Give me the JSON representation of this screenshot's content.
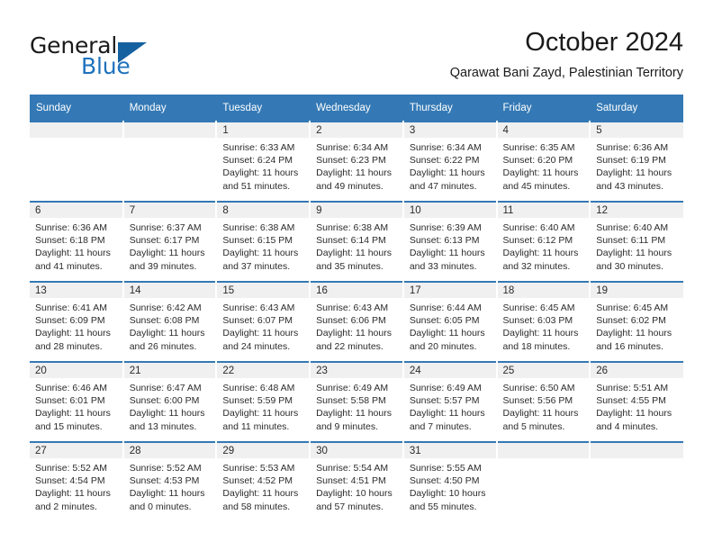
{
  "brand": {
    "name_top": "General",
    "name_bottom": "Blue",
    "accent_color": "#1f72bd",
    "triangle_color": "#15619f"
  },
  "header": {
    "month_title": "October 2024",
    "location": "Qarawat Bani Zayd, Palestinian Territory"
  },
  "theme": {
    "header_row_bg": "#3479b5",
    "date_band_bg": "#f0f0f0",
    "text_color": "#2b2b2b"
  },
  "calendar": {
    "weekday_headers": [
      "Sunday",
      "Monday",
      "Tuesday",
      "Wednesday",
      "Thursday",
      "Friday",
      "Saturday"
    ],
    "weeks": [
      [
        {
          "day": "",
          "sunrise": "",
          "sunset": "",
          "daylight_line1": "",
          "daylight_line2": ""
        },
        {
          "day": "",
          "sunrise": "",
          "sunset": "",
          "daylight_line1": "",
          "daylight_line2": ""
        },
        {
          "day": "1",
          "sunrise": "Sunrise: 6:33 AM",
          "sunset": "Sunset: 6:24 PM",
          "daylight_line1": "Daylight: 11 hours",
          "daylight_line2": "and 51 minutes."
        },
        {
          "day": "2",
          "sunrise": "Sunrise: 6:34 AM",
          "sunset": "Sunset: 6:23 PM",
          "daylight_line1": "Daylight: 11 hours",
          "daylight_line2": "and 49 minutes."
        },
        {
          "day": "3",
          "sunrise": "Sunrise: 6:34 AM",
          "sunset": "Sunset: 6:22 PM",
          "daylight_line1": "Daylight: 11 hours",
          "daylight_line2": "and 47 minutes."
        },
        {
          "day": "4",
          "sunrise": "Sunrise: 6:35 AM",
          "sunset": "Sunset: 6:20 PM",
          "daylight_line1": "Daylight: 11 hours",
          "daylight_line2": "and 45 minutes."
        },
        {
          "day": "5",
          "sunrise": "Sunrise: 6:36 AM",
          "sunset": "Sunset: 6:19 PM",
          "daylight_line1": "Daylight: 11 hours",
          "daylight_line2": "and 43 minutes."
        }
      ],
      [
        {
          "day": "6",
          "sunrise": "Sunrise: 6:36 AM",
          "sunset": "Sunset: 6:18 PM",
          "daylight_line1": "Daylight: 11 hours",
          "daylight_line2": "and 41 minutes."
        },
        {
          "day": "7",
          "sunrise": "Sunrise: 6:37 AM",
          "sunset": "Sunset: 6:17 PM",
          "daylight_line1": "Daylight: 11 hours",
          "daylight_line2": "and 39 minutes."
        },
        {
          "day": "8",
          "sunrise": "Sunrise: 6:38 AM",
          "sunset": "Sunset: 6:15 PM",
          "daylight_line1": "Daylight: 11 hours",
          "daylight_line2": "and 37 minutes."
        },
        {
          "day": "9",
          "sunrise": "Sunrise: 6:38 AM",
          "sunset": "Sunset: 6:14 PM",
          "daylight_line1": "Daylight: 11 hours",
          "daylight_line2": "and 35 minutes."
        },
        {
          "day": "10",
          "sunrise": "Sunrise: 6:39 AM",
          "sunset": "Sunset: 6:13 PM",
          "daylight_line1": "Daylight: 11 hours",
          "daylight_line2": "and 33 minutes."
        },
        {
          "day": "11",
          "sunrise": "Sunrise: 6:40 AM",
          "sunset": "Sunset: 6:12 PM",
          "daylight_line1": "Daylight: 11 hours",
          "daylight_line2": "and 32 minutes."
        },
        {
          "day": "12",
          "sunrise": "Sunrise: 6:40 AM",
          "sunset": "Sunset: 6:11 PM",
          "daylight_line1": "Daylight: 11 hours",
          "daylight_line2": "and 30 minutes."
        }
      ],
      [
        {
          "day": "13",
          "sunrise": "Sunrise: 6:41 AM",
          "sunset": "Sunset: 6:09 PM",
          "daylight_line1": "Daylight: 11 hours",
          "daylight_line2": "and 28 minutes."
        },
        {
          "day": "14",
          "sunrise": "Sunrise: 6:42 AM",
          "sunset": "Sunset: 6:08 PM",
          "daylight_line1": "Daylight: 11 hours",
          "daylight_line2": "and 26 minutes."
        },
        {
          "day": "15",
          "sunrise": "Sunrise: 6:43 AM",
          "sunset": "Sunset: 6:07 PM",
          "daylight_line1": "Daylight: 11 hours",
          "daylight_line2": "and 24 minutes."
        },
        {
          "day": "16",
          "sunrise": "Sunrise: 6:43 AM",
          "sunset": "Sunset: 6:06 PM",
          "daylight_line1": "Daylight: 11 hours",
          "daylight_line2": "and 22 minutes."
        },
        {
          "day": "17",
          "sunrise": "Sunrise: 6:44 AM",
          "sunset": "Sunset: 6:05 PM",
          "daylight_line1": "Daylight: 11 hours",
          "daylight_line2": "and 20 minutes."
        },
        {
          "day": "18",
          "sunrise": "Sunrise: 6:45 AM",
          "sunset": "Sunset: 6:03 PM",
          "daylight_line1": "Daylight: 11 hours",
          "daylight_line2": "and 18 minutes."
        },
        {
          "day": "19",
          "sunrise": "Sunrise: 6:45 AM",
          "sunset": "Sunset: 6:02 PM",
          "daylight_line1": "Daylight: 11 hours",
          "daylight_line2": "and 16 minutes."
        }
      ],
      [
        {
          "day": "20",
          "sunrise": "Sunrise: 6:46 AM",
          "sunset": "Sunset: 6:01 PM",
          "daylight_line1": "Daylight: 11 hours",
          "daylight_line2": "and 15 minutes."
        },
        {
          "day": "21",
          "sunrise": "Sunrise: 6:47 AM",
          "sunset": "Sunset: 6:00 PM",
          "daylight_line1": "Daylight: 11 hours",
          "daylight_line2": "and 13 minutes."
        },
        {
          "day": "22",
          "sunrise": "Sunrise: 6:48 AM",
          "sunset": "Sunset: 5:59 PM",
          "daylight_line1": "Daylight: 11 hours",
          "daylight_line2": "and 11 minutes."
        },
        {
          "day": "23",
          "sunrise": "Sunrise: 6:49 AM",
          "sunset": "Sunset: 5:58 PM",
          "daylight_line1": "Daylight: 11 hours",
          "daylight_line2": "and 9 minutes."
        },
        {
          "day": "24",
          "sunrise": "Sunrise: 6:49 AM",
          "sunset": "Sunset: 5:57 PM",
          "daylight_line1": "Daylight: 11 hours",
          "daylight_line2": "and 7 minutes."
        },
        {
          "day": "25",
          "sunrise": "Sunrise: 6:50 AM",
          "sunset": "Sunset: 5:56 PM",
          "daylight_line1": "Daylight: 11 hours",
          "daylight_line2": "and 5 minutes."
        },
        {
          "day": "26",
          "sunrise": "Sunrise: 5:51 AM",
          "sunset": "Sunset: 4:55 PM",
          "daylight_line1": "Daylight: 11 hours",
          "daylight_line2": "and 4 minutes."
        }
      ],
      [
        {
          "day": "27",
          "sunrise": "Sunrise: 5:52 AM",
          "sunset": "Sunset: 4:54 PM",
          "daylight_line1": "Daylight: 11 hours",
          "daylight_line2": "and 2 minutes."
        },
        {
          "day": "28",
          "sunrise": "Sunrise: 5:52 AM",
          "sunset": "Sunset: 4:53 PM",
          "daylight_line1": "Daylight: 11 hours",
          "daylight_line2": "and 0 minutes."
        },
        {
          "day": "29",
          "sunrise": "Sunrise: 5:53 AM",
          "sunset": "Sunset: 4:52 PM",
          "daylight_line1": "Daylight: 11 hours",
          "daylight_line2": "and 58 minutes."
        },
        {
          "day": "30",
          "sunrise": "Sunrise: 5:54 AM",
          "sunset": "Sunset: 4:51 PM",
          "daylight_line1": "Daylight: 10 hours",
          "daylight_line2": "and 57 minutes."
        },
        {
          "day": "31",
          "sunrise": "Sunrise: 5:55 AM",
          "sunset": "Sunset: 4:50 PM",
          "daylight_line1": "Daylight: 10 hours",
          "daylight_line2": "and 55 minutes."
        },
        {
          "day": "",
          "sunrise": "",
          "sunset": "",
          "daylight_line1": "",
          "daylight_line2": ""
        },
        {
          "day": "",
          "sunrise": "",
          "sunset": "",
          "daylight_line1": "",
          "daylight_line2": ""
        }
      ]
    ]
  }
}
